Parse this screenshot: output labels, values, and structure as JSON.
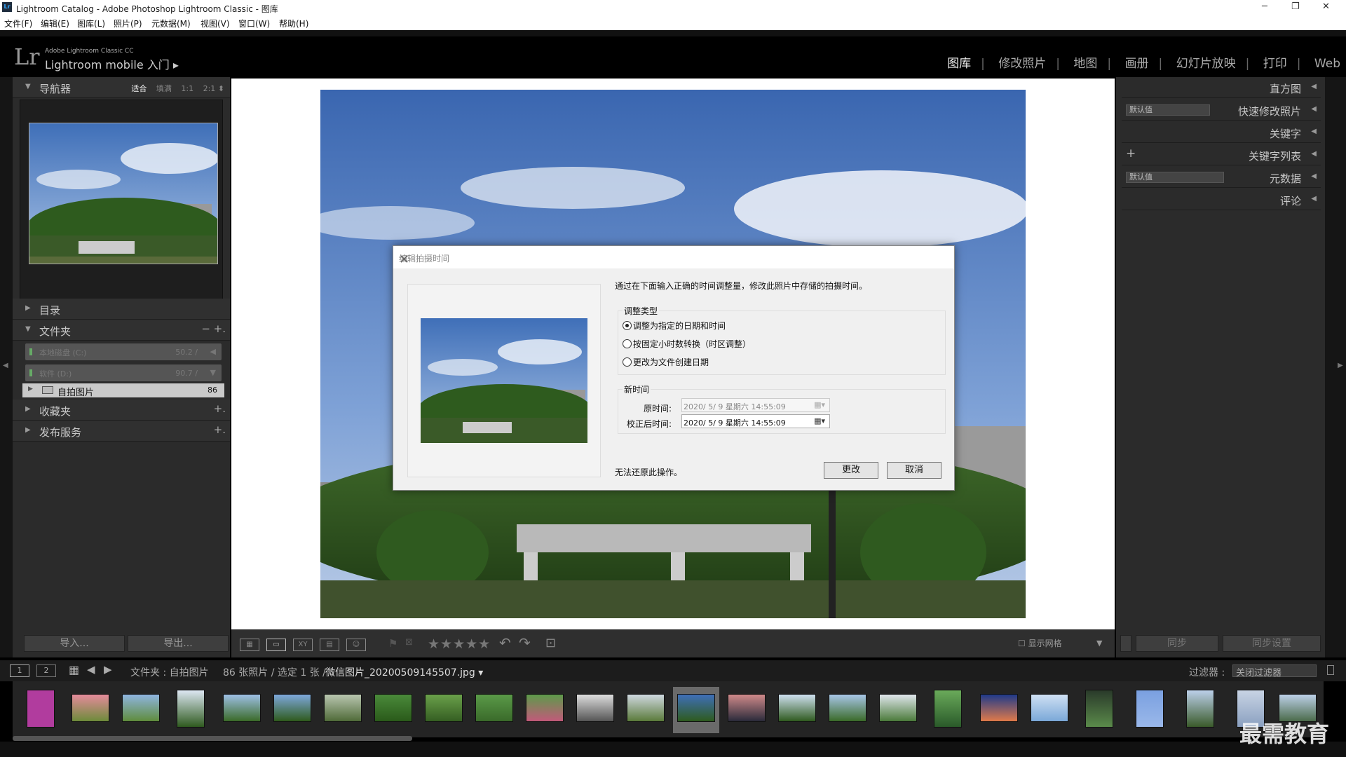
{
  "window": {
    "title": "Lightroom Catalog - Adobe Photoshop Lightroom Classic - 图库",
    "app_icon": "Lr"
  },
  "menubar": [
    "文件(F)",
    "编辑(E)",
    "图库(L)",
    "照片(P)",
    "元数据(M)",
    "视图(V)",
    "窗口(W)",
    "帮助(H)"
  ],
  "header": {
    "logo": "Lr",
    "brand_small": "Adobe Lightroom Classic CC",
    "brand_main": "Lightroom mobile 入门",
    "modules": [
      "图库",
      "修改照片",
      "地图",
      "画册",
      "幻灯片放映",
      "打印",
      "Web"
    ],
    "active_module": "图库"
  },
  "left": {
    "navigator": {
      "label": "导航器",
      "options": [
        "适合",
        "填满",
        "1:1",
        "2:1"
      ],
      "active_option": "适合"
    },
    "catalog": "目录",
    "folders": {
      "label": "文件夹",
      "minus": "−",
      "plus": "+.",
      "volumes": [
        {
          "name": "本地磁盘 (C:)",
          "size": "50.2 /"
        },
        {
          "name": "软件 (D:)",
          "size": "90.7 /"
        }
      ],
      "folder": {
        "name": "自拍图片",
        "count": "86"
      }
    },
    "collections": "收藏夹",
    "publish": "发布服务",
    "import_label": "导入...",
    "export_label": "导出..."
  },
  "right": {
    "histogram": "直方图",
    "quick_develop": {
      "label": "快速修改照片",
      "preset": "默认值"
    },
    "keywording": "关键字",
    "keyword_list": {
      "label": "关键字列表",
      "plus": "+"
    },
    "metadata": {
      "label": "元数据",
      "preset": "默认值"
    },
    "comments": "评论",
    "sync_label": "同步",
    "sync_settings_label": "同步设置"
  },
  "toolbar": {
    "stars": "★★★★★",
    "show_grid": "显示网格",
    "xy": "XY"
  },
  "filmstrip_bar": {
    "page1": "1",
    "page2": "2",
    "path": "文件夹 : 自拍图片",
    "count": "86 张照片 / 选定 1 张 /",
    "filename": "微信图片_20200509145507.jpg",
    "filter_label": "过滤器 :",
    "filter_value": "关闭过滤器"
  },
  "dialog": {
    "title": "编辑拍摄时间",
    "intro": "通过在下面输入正确的时间调整量，修改此照片中存储的拍摄时间。",
    "adjust_group": "调整类型",
    "options": [
      "调整为指定的日期和时间",
      "按固定小时数转换（时区调整）",
      "更改为文件创建日期"
    ],
    "selected_option": 0,
    "new_time_group": "新时间",
    "original_label": "原时间:",
    "original_value": "2020/ 5/ 9 星期六 14:55:09",
    "corrected_label": "校正后时间:",
    "corrected_value": "2020/ 5/ 9 星期六 14:55:09",
    "warning": "无法还原此操作。",
    "change_label": "更改",
    "cancel_label": "取消"
  },
  "watermark": "最需教育"
}
